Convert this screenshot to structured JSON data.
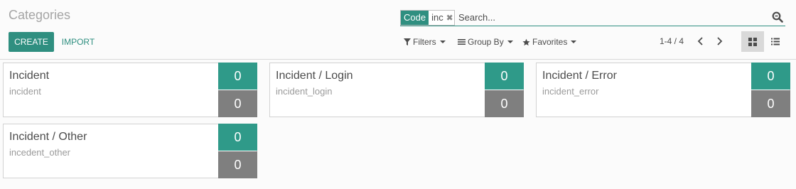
{
  "page": {
    "title": "Categories",
    "create_label": "CREATE",
    "import_label": "IMPORT"
  },
  "search": {
    "facet_label": "Code",
    "facet_value": "inc",
    "placeholder": "Search..."
  },
  "search_options": {
    "filters": "Filters",
    "group_by": "Group By",
    "favorites": "Favorites"
  },
  "pager": {
    "value": "1-4 / 4"
  },
  "colors": {
    "accent": "#2f8f80",
    "count_primary": "#2f9a89",
    "count_secondary": "#7f7f7f"
  },
  "cards": [
    {
      "name": "Incident",
      "code": "incident",
      "count_top": "0",
      "count_bottom": "0"
    },
    {
      "name": "Incident / Login",
      "code": "incident_login",
      "count_top": "0",
      "count_bottom": "0"
    },
    {
      "name": "Incident / Error",
      "code": "incident_error",
      "count_top": "0",
      "count_bottom": "0"
    },
    {
      "name": "Incident / Other",
      "code": "incedent_other",
      "count_top": "0",
      "count_bottom": "0"
    }
  ]
}
